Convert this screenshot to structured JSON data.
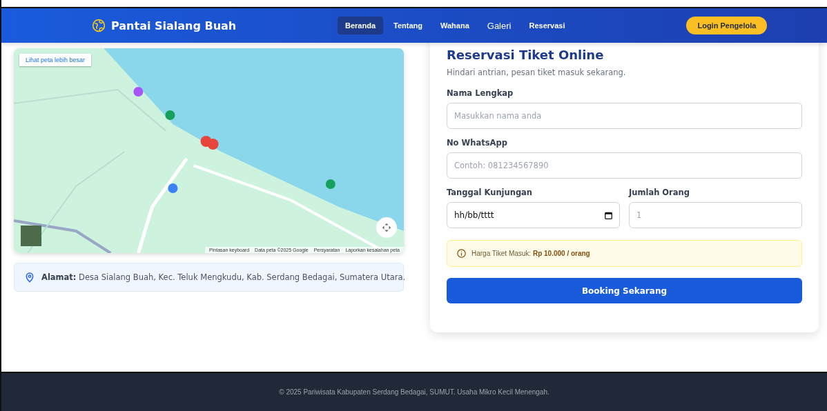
{
  "header": {
    "brand": "Pantai Sialang Buah",
    "nav": [
      {
        "label": "Beranda",
        "selected": true
      },
      {
        "label": "Tentang",
        "selected": false
      },
      {
        "label": "Wahana",
        "selected": false
      },
      {
        "label": "Galeri",
        "selected": false
      },
      {
        "label": "Reservasi",
        "selected": false
      }
    ],
    "login_button": "Login Pengelola"
  },
  "location": {
    "map": {
      "larger_map_link": "Lihat peta lebih besar",
      "attribution": [
        "Pintasan keyboard",
        "Data peta ©2025 Google",
        "Persyaratan",
        "Laporkan kesalahan peta"
      ]
    },
    "address": "**Alamat:** Desa Sialang Buah, Kec. Teluk Mengkudu, Kab. Serdang Bedagai, Sumatera Utara."
  },
  "reservation": {
    "title": "Reservasi Tiket Online",
    "subtitle": "Hindari antrian, pesan tiket masuk sekarang.",
    "fields": [
      {
        "label": "Nama Lengkap",
        "placeholder": "Masukkan nama anda"
      },
      {
        "label": "No WhatsApp",
        "placeholder": "Contoh: 081234567890"
      }
    ],
    "date": {
      "label": "Tanggal Kunjungan",
      "value": "hh/bb/tttt"
    },
    "count": {
      "label": "Jumlah Orang",
      "placeholder": "1"
    },
    "price_note": "Harga Tiket Masuk: **Rp 10.000 / orang**",
    "submit": "Booking Sekarang"
  },
  "footer": "© 2025 Pariwisata Kabupaten Serdang Bedagai, SUMUT. Usaha Mikro Kecil Menengah."
}
